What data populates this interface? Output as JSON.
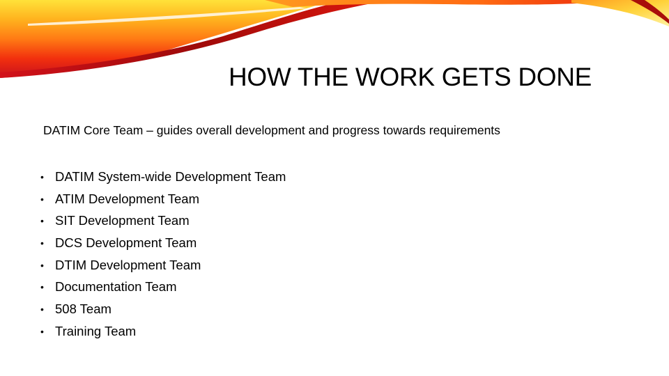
{
  "slide": {
    "title": "HOW THE WORK GETS DONE",
    "subheading": "DATIM Core Team – guides overall development and progress towards requirements",
    "bullet_glyph": "•",
    "bullets": [
      {
        "label": "DATIM System-wide Development Team"
      },
      {
        "label": "ATIM Development Team"
      },
      {
        "label": "SIT Development Team"
      },
      {
        "label": "DCS Development Team"
      },
      {
        "label": "DTIM Development Team"
      },
      {
        "label": "Documentation Team"
      },
      {
        "label": "508 Team"
      },
      {
        "label": "Training Team"
      }
    ],
    "decoration": {
      "name": "swoosh-banner",
      "colors": {
        "yellow": "#FFD21E",
        "orange": "#FF8A12",
        "red": "#E8140C",
        "dark_red": "#9E0A0A"
      }
    }
  }
}
